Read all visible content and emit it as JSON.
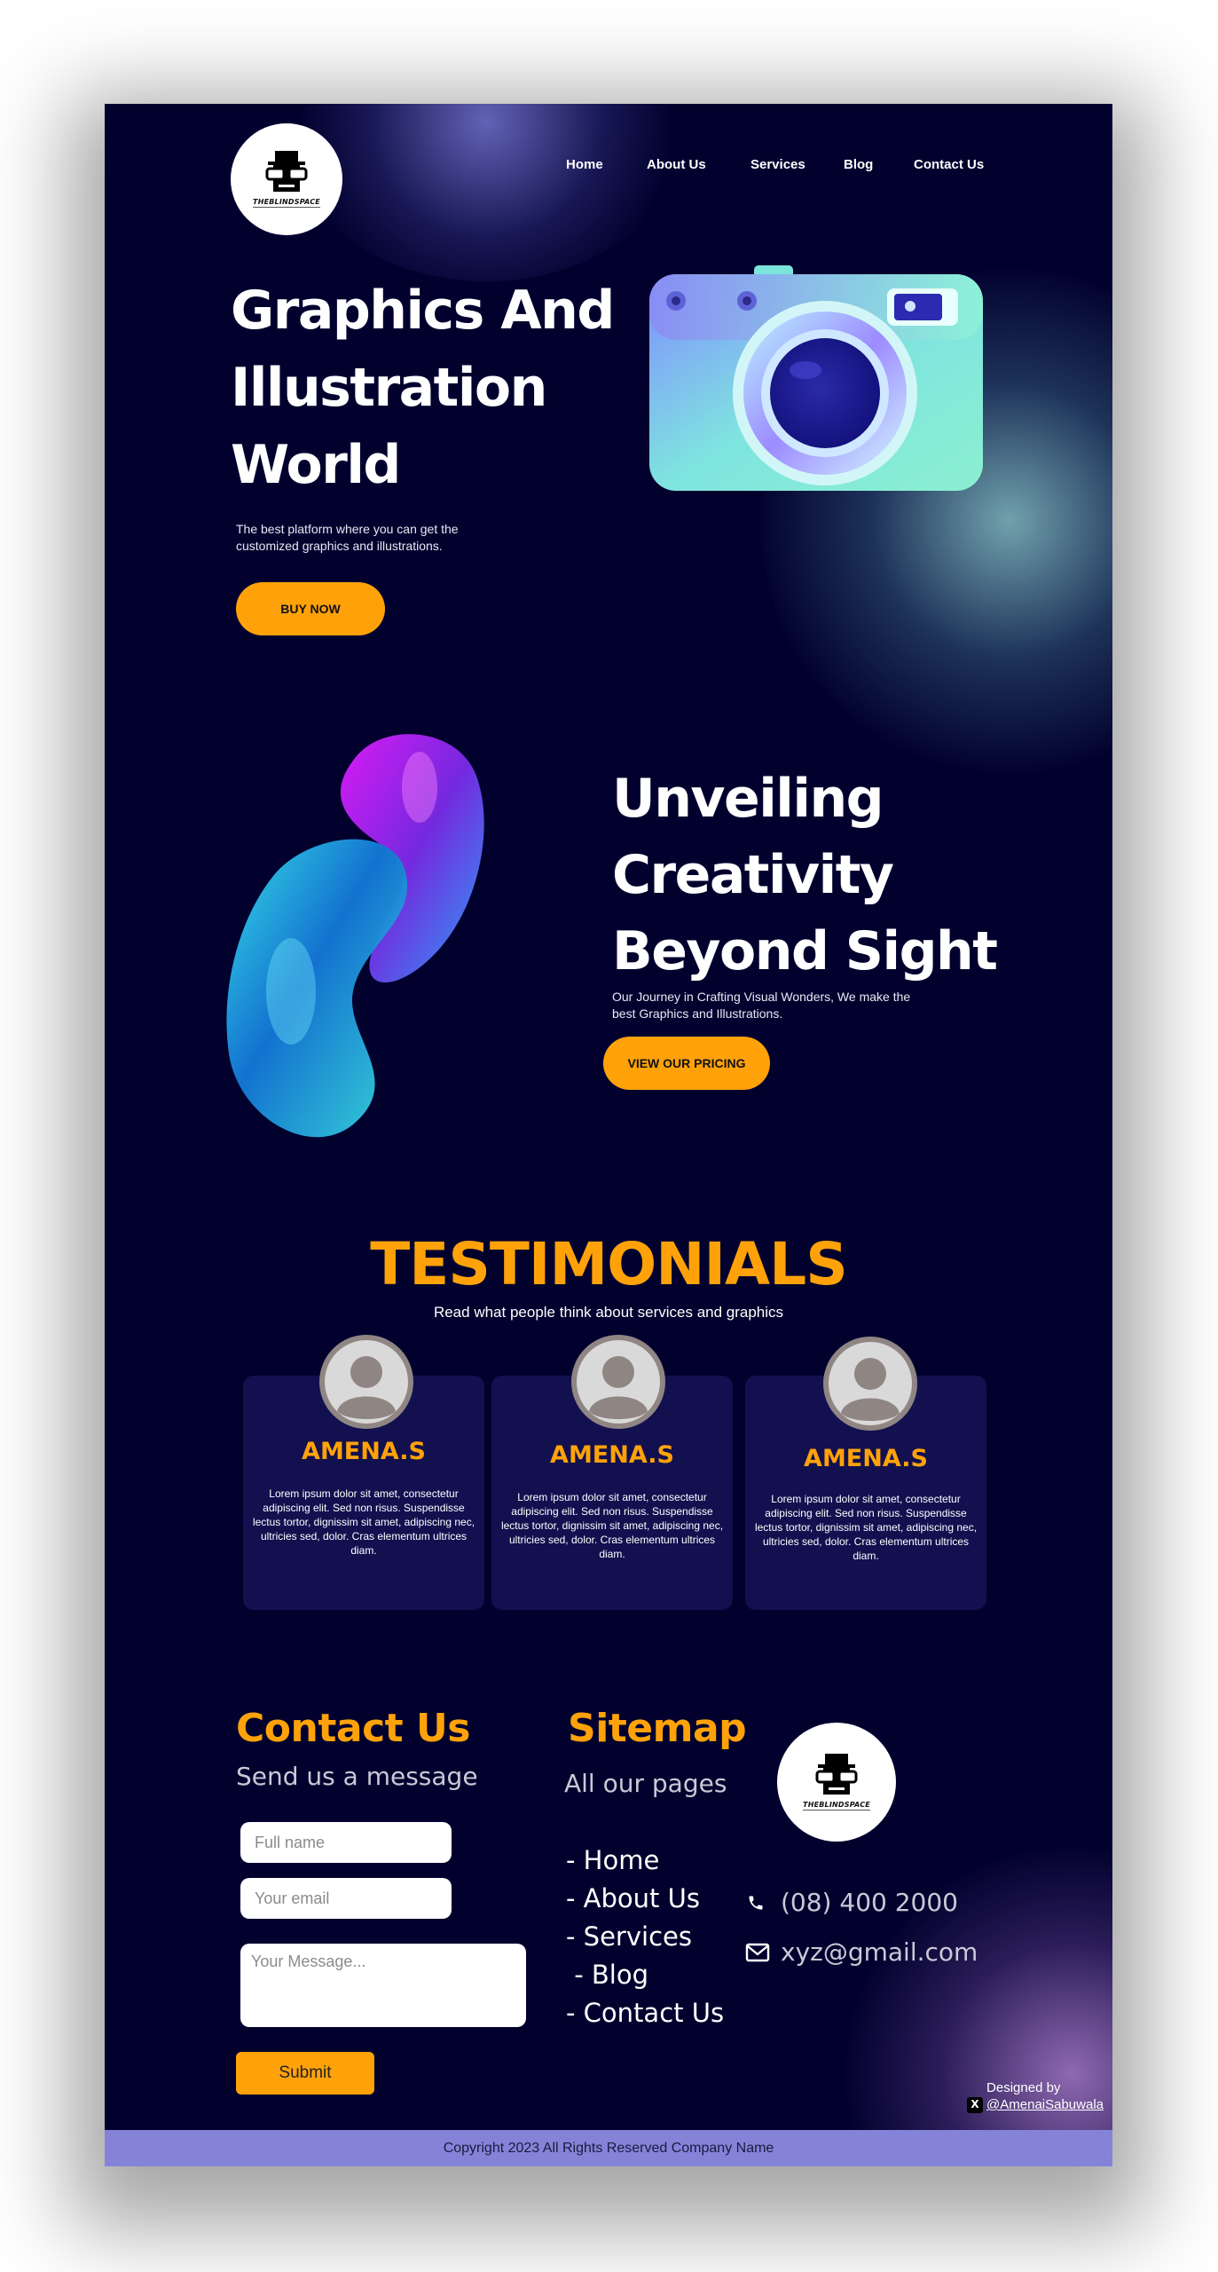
{
  "brand": {
    "logo_text": "THEBLINDSPACE"
  },
  "nav": {
    "items": [
      "Home",
      "About Us",
      "Services",
      "Blog",
      "Contact Us"
    ]
  },
  "hero": {
    "title": "Graphics And Illustration World",
    "subtitle": "The best platform where you can get the customized graphics and illustrations.",
    "cta": "BUY NOW"
  },
  "section2": {
    "title": "Unveiling Creativity Beyond Sight",
    "subtitle": "Our Journey in Crafting Visual Wonders, We make the best Graphics and Illustrations.",
    "cta": "VIEW OUR PRICING"
  },
  "testimonials": {
    "title": "TESTIMONIALS",
    "subtitle": "Read what people think about services and graphics",
    "cards": [
      {
        "name": "AMENA.S",
        "text": "Lorem ipsum dolor sit amet, consectetur adipiscing elit. Sed non risus. Suspendisse lectus tortor, dignissim sit amet, adipiscing nec, ultricies sed, dolor. Cras elementum ultrices diam."
      },
      {
        "name": "AMENA.S",
        "text": "Lorem ipsum dolor sit amet, consectetur adipiscing elit. Sed non risus. Suspendisse lectus tortor, dignissim sit amet, adipiscing nec, ultricies sed, dolor. Cras elementum ultrices diam."
      },
      {
        "name": "AMENA.S",
        "text": "Lorem ipsum dolor sit amet, consectetur adipiscing elit. Sed non risus. Suspendisse lectus tortor, dignissim sit amet, adipiscing nec, ultricies sed, dolor. Cras elementum ultrices diam."
      }
    ]
  },
  "contact": {
    "title": "Contact Us",
    "subtitle": "Send us a message",
    "name_placeholder": "Full name",
    "email_placeholder": "Your email",
    "message_placeholder": "Your Message...",
    "submit": "Submit"
  },
  "sitemap": {
    "title": "Sitemap",
    "subtitle": "All our pages",
    "items": [
      "- Home",
      "- About Us",
      "- Services",
      " - Blog",
      "- Contact Us"
    ]
  },
  "info": {
    "phone": "(08) 400 2000",
    "email": "xyz@gmail.com"
  },
  "credit": {
    "label": "Designed by",
    "handle": "@AmenaiSabuwala"
  },
  "footer": {
    "copyright": "Copyright 2023 All Rights Reserved Company Name"
  },
  "colors": {
    "background": "#02012e",
    "accent": "#ffa20a",
    "card": "#12104f",
    "footer_bar": "#8483d8"
  },
  "icons": [
    "phone-icon",
    "envelope-icon",
    "x-logo-icon",
    "user-avatar-icon"
  ]
}
